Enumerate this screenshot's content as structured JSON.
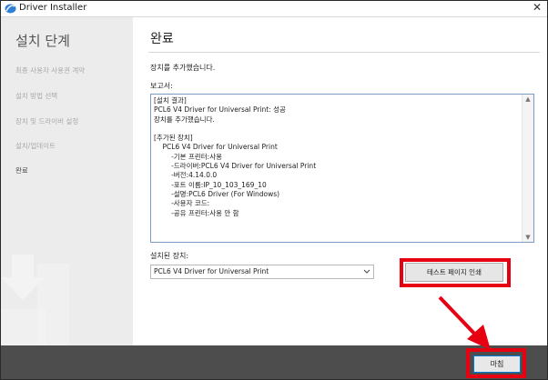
{
  "window": {
    "title": "Driver Installer",
    "close_glyph": "✕"
  },
  "sidebar": {
    "title": "설치 단계",
    "items": [
      {
        "label": "최종 사용자 사용권 계약",
        "active": false
      },
      {
        "label": "설치 방법 선택",
        "active": false
      },
      {
        "label": "장치 및 드라이버 설정",
        "active": false
      },
      {
        "label": "설치/업데이트",
        "active": false
      },
      {
        "label": "완료",
        "active": true
      }
    ]
  },
  "main": {
    "title": "완료",
    "status_message": "장치를 추가했습니다.",
    "report_label": "보고서:",
    "report_lines": [
      "[설치 결과]",
      "PCL6 V4 Driver for Universal Print: 성공",
      "장치를 추가했습니다.",
      "",
      "[추가된 장치]",
      "    PCL6 V4 Driver for Universal Print",
      "        -기본 프린터:사용",
      "        -드라이버:PCL6 V4 Driver for Universal Print",
      "        -버전:4.14.0.0",
      "        -포트 이름:IP_10_103_169_10",
      "        -설명:PCL6 Driver (For Windows)",
      "        -사용자 코드:",
      "        -공유 프린터:사용 안 함"
    ],
    "installed_label": "설치된 장치:",
    "installed_device_value": "PCL6 V4 Driver for Universal Print",
    "test_print_button": "테스트 페이지 인쇄"
  },
  "footer": {
    "finish_button": "마침"
  },
  "colors": {
    "highlight": "#e60012",
    "footer": "#4d4d4d",
    "sidebar": "#ececec"
  }
}
